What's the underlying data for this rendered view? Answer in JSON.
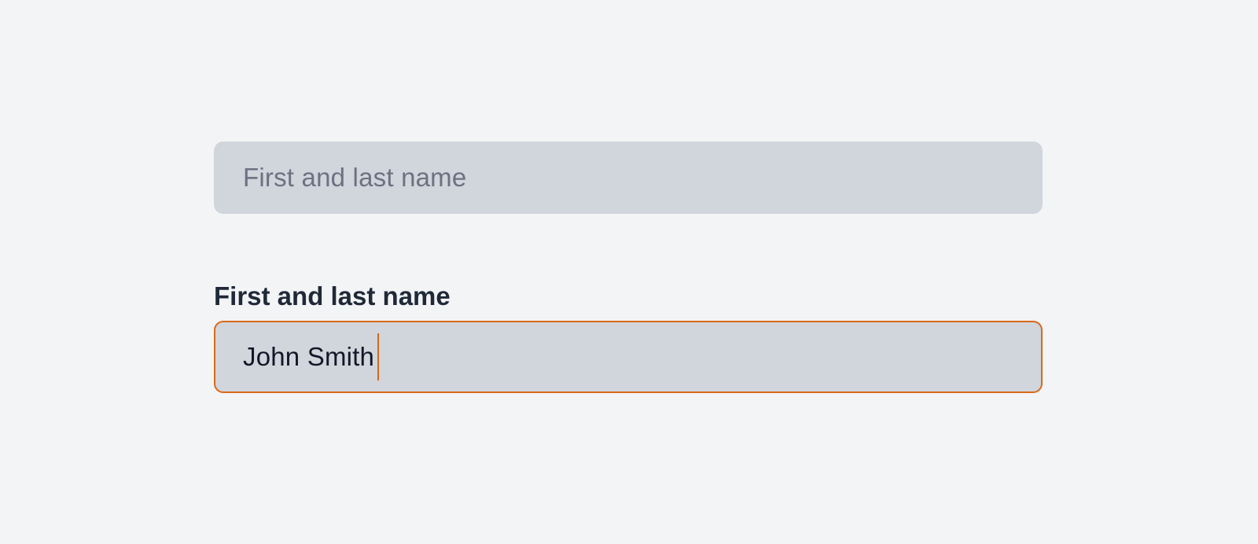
{
  "empty_field": {
    "placeholder": "First and last name"
  },
  "filled_field": {
    "label": "First and last name",
    "value": "John Smith",
    "focus_color": "#d9691a"
  },
  "colors": {
    "background": "#f3f4f6",
    "input_fill": "#d1d5dc",
    "placeholder_text": "#6b7280",
    "label_text": "#1f2937",
    "value_text": "#111827",
    "focus_border": "#d9691a"
  }
}
